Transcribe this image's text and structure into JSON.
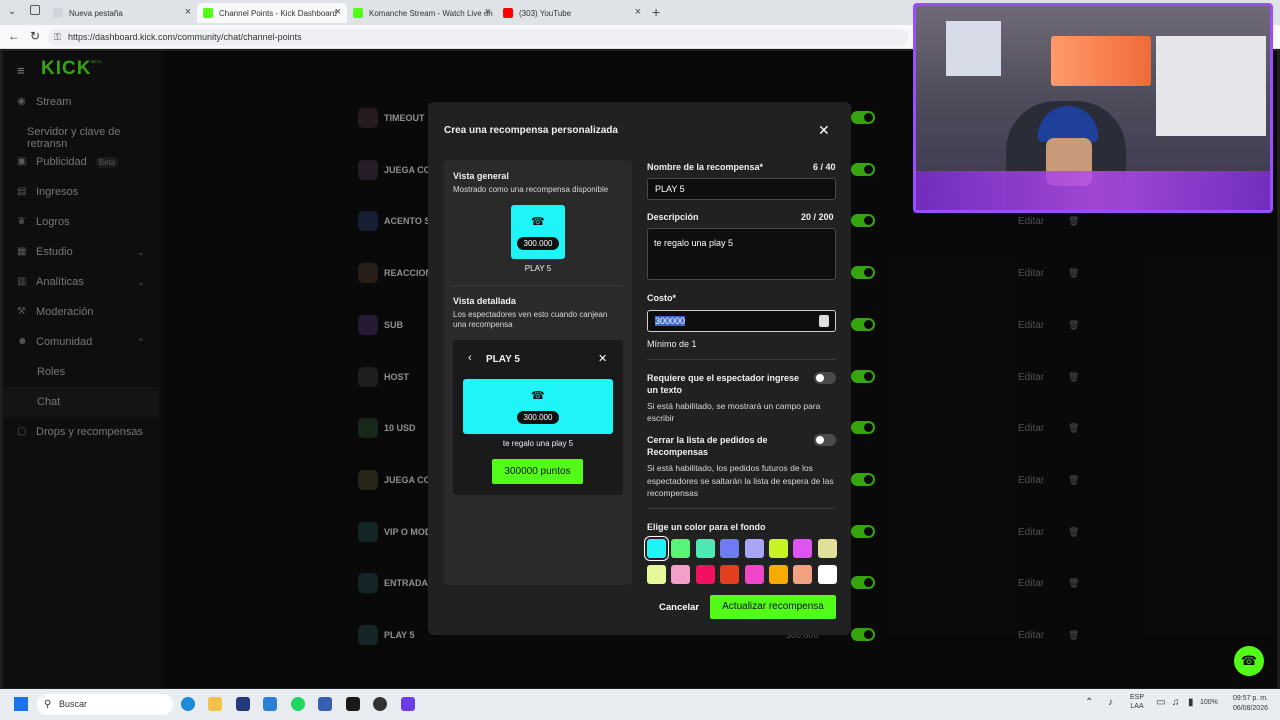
{
  "browser": {
    "tabs": [
      {
        "title": "Nueva pestaña",
        "color": "#cfd4da"
      },
      {
        "title": "Channel Points - Kick Dashboard",
        "color": "#53fc18"
      },
      {
        "title": "Komanche Stream - Watch Live on",
        "color": "#53fc18"
      },
      {
        "title": "(303) YouTube",
        "color": "#ff0000"
      }
    ],
    "url": "https://dashboard.kick.com/community/chat/channel-points"
  },
  "app": {
    "logo": "KICK",
    "logo_sup": "BETA",
    "nav": {
      "stream": "Stream",
      "server_key": "Servidor y clave de retransn",
      "publicidad": "Publicidad",
      "beta": "Beta",
      "ingresos": "Ingresos",
      "logros": "Logros",
      "estudio": "Estudio",
      "analiticas": "Analíticas",
      "moderacion": "Moderación",
      "comunidad": "Comunidad",
      "roles": "Roles",
      "chat": "Chat",
      "drops": "Drops y recompensas"
    },
    "rewards": [
      {
        "label": "TIMEOUT",
        "color": "#3a2a2e",
        "cost": ""
      },
      {
        "label": "JUEGA CO",
        "color": "#3a2d3d",
        "cost": ""
      },
      {
        "label": "ACENTO S",
        "color": "#23304f",
        "cost": ""
      },
      {
        "label": "REACCION",
        "color": "#3d2f24",
        "cost": ""
      },
      {
        "label": "SUB",
        "color": "#3a2a52",
        "cost": ""
      },
      {
        "label": "HOST",
        "color": "#2e2e2e",
        "cost": ""
      },
      {
        "label": "10 USD",
        "color": "#24402a",
        "cost": ""
      },
      {
        "label": "JUEGA CO",
        "color": "#3b3a24",
        "cost": ""
      },
      {
        "label": "VIP O MOD",
        "color": "#1f3d3c",
        "cost": ""
      },
      {
        "label": "ENTRADA",
        "color": "#1f3d3c",
        "cost": ""
      },
      {
        "label": "PLAY 5",
        "color": "#1f3a3c",
        "cost": "300.000"
      }
    ],
    "edit_label": "Editar"
  },
  "modal": {
    "title": "Crea una recompensa personalizada",
    "overview_title": "Vista general",
    "overview_sub": "Mostrado como una recompensa disponible",
    "card_cost": "300.000",
    "card_name": "PLAY 5",
    "detail_title": "Vista detallada",
    "detail_sub": "Los espectadores ven esto cuando canjean una recompensa",
    "detail_header": "PLAY 5",
    "detail_desc": "te regalo una play 5",
    "detail_button": "300000 puntos",
    "name_label": "Nombre de la recompensa*",
    "name_count": "6 / 40",
    "name_value": "PLAY 5",
    "desc_label": "Descripción",
    "desc_count": "20 / 200",
    "desc_value": "te regalo una play 5",
    "cost_label": "Costo*",
    "cost_value": "300000",
    "cost_min": "Mínimo de 1",
    "req_label": "Requiere que el espectador ingrese un texto",
    "req_help": "Si está habilitado, se mostrará un campo para escribir",
    "close_label": "Cerrar la lista de pedidos de Recompensas",
    "close_help": "Si está habilitado, los pedidos futuros de los espectadores se saltarán la lista de espera de las recompensas",
    "color_label": "Elige un color para el fondo",
    "colors": [
      "#1ff4f8",
      "#58f47a",
      "#4ee8b5",
      "#6f7bf2",
      "#a8a6f5",
      "#c7f322",
      "#dd55f0",
      "#e0e09a",
      "#e7f89a",
      "#f3a0c9",
      "#f21060",
      "#e33f1e",
      "#f046c9",
      "#f6ab00",
      "#f0a280",
      "#ffffff"
    ],
    "cancel": "Cancelar",
    "submit": "Actualizar recompensa"
  },
  "taskbar": {
    "search": "Buscar",
    "lang1": "ESP",
    "lang2": "LAA",
    "battery": "100%",
    "time": "09:57 p. m.",
    "date": "06/08/2026"
  }
}
